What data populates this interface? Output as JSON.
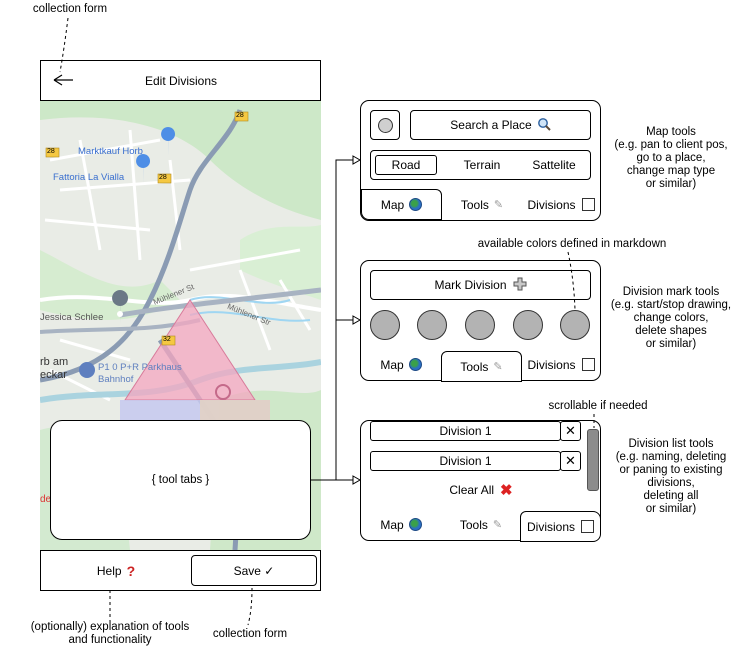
{
  "annotations": {
    "top_left": "collection form",
    "bottom_left": "(optionally) explanation of tools and functionality",
    "bottom_center": "collection form",
    "map_tools": [
      "Map tools",
      "(e.g. pan to client pos,",
      "go to a place,",
      "change map type",
      "or similar)"
    ],
    "colors_note": "available colors defined in markdown",
    "mark_tools": [
      "Division mark tools",
      "(e.g. start/stop drawing,",
      "change colors,",
      "delete shapes",
      "or similar)"
    ],
    "scroll_note": "scrollable if needed",
    "list_tools": [
      "Division list tools",
      "(e.g. naming, deleting",
      "or paning to existing",
      "divisions,",
      "deleting all",
      "or similar)"
    ]
  },
  "phone": {
    "header": {
      "back_icon": "arrow-left-icon",
      "title": "Edit Divisions"
    },
    "tool_tabs_placeholder": "{ tool tabs }",
    "footer": {
      "help_label": "Help",
      "help_icon": "question-mark-icon",
      "save_label": "Save ✓"
    },
    "map": {
      "labels": {
        "marktkauf": "Marktkauf Horb",
        "fattoria": "Fattoria La Vialla",
        "jessica": "Jessica Schlee",
        "horb": "rb am",
        "neckar": "eckar",
        "parkhaus": "P1 0 P+R Parkhaus",
        "bahnhof": "Bahnhof",
        "muehlener1": "Mühlener St",
        "muehlener2": "Mühlener Str",
        "road28a": "28",
        "road28b": "28",
        "road28c": "28",
        "road32": "32",
        "red_text": "de"
      }
    }
  },
  "panel_map": {
    "locate_icon": "locate-circle-icon",
    "search_label": "Search a Place",
    "search_icon": "magnifier-icon",
    "map_types": [
      "Road",
      "Terrain",
      "Sattelite"
    ],
    "selected_type": "Road",
    "tabs": {
      "map": "Map",
      "tools": "Tools",
      "divisions": "Divisions"
    },
    "active_tab": "Map"
  },
  "panel_mark": {
    "mark_label": "Mark Division",
    "mark_icon": "plus-icon",
    "color_count": 5,
    "color": "#b3b3b3",
    "tabs": {
      "map": "Map",
      "tools": "Tools",
      "divisions": "Divisions"
    },
    "active_tab": "Tools"
  },
  "panel_list": {
    "divisions": [
      "Division 1",
      "Division 1"
    ],
    "delete_icon": "close-x-icon",
    "clear_label": "Clear All",
    "clear_icon": "red-x-icon",
    "tabs": {
      "map": "Map",
      "tools": "Tools",
      "divisions": "Divisions"
    },
    "active_tab": "Divisions"
  }
}
